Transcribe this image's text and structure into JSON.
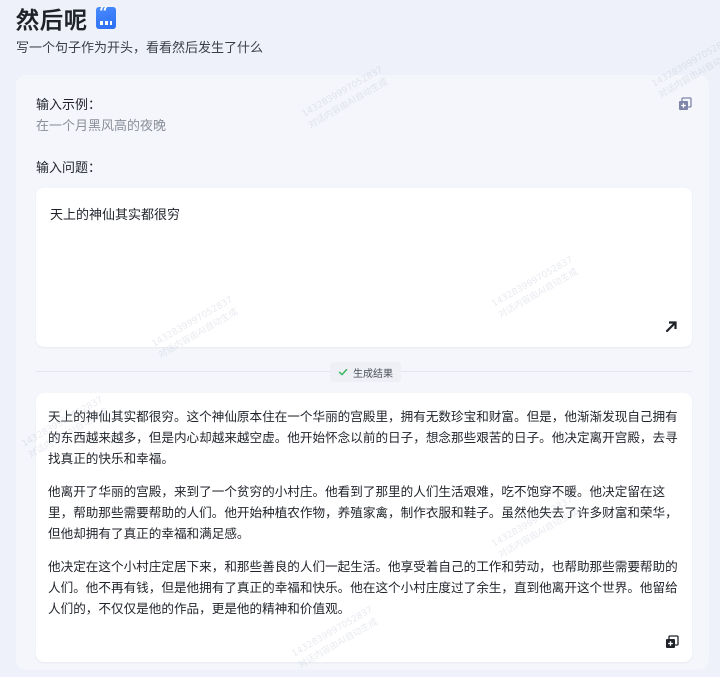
{
  "header": {
    "title": "然后呢",
    "subtitle": "写一个句子作为开头，看看然后发生了什么"
  },
  "example": {
    "label": "输入示例：",
    "text": "在一个月黑风高的夜晚"
  },
  "question": {
    "label": "输入问题：",
    "value": "天上的神仙其实都很穷"
  },
  "result": {
    "tag": "生成结果",
    "paragraphs": [
      "天上的神仙其实都很穷。这个神仙原本住在一个华丽的宫殿里，拥有无数珍宝和财富。但是，他渐渐发现自己拥有的东西越来越多，但是内心却越来越空虚。他开始怀念以前的日子，想念那些艰苦的日子。他决定离开宫殿，去寻找真正的快乐和幸福。",
      "他离开了华丽的宫殿，来到了一个贫穷的小村庄。他看到了那里的人们生活艰难，吃不饱穿不暖。他决定留在这里，帮助那些需要帮助的人们。他开始种植农作物，养殖家禽，制作衣服和鞋子。虽然他失去了许多财富和荣华，但他却拥有了真正的幸福和满足感。",
      "他决定在这个小村庄定居下来，和那些善良的人们一起生活。他享受着自己的工作和劳动，也帮助那些需要帮助的人们。他不再有钱，但是他拥有了真正的幸福和快乐。他在这个小村庄度过了余生，直到他离开这个世界。他留给人们的，不仅仅是他的作品，更是他的精神和价值观。"
    ]
  },
  "watermark": {
    "line1": "14328399970528​37",
    "line2": "对话内容由AI自动生成"
  },
  "icons": {
    "title": "quote-chat-icon",
    "copy_top": "copy-icon",
    "send": "arrow-up-right-icon",
    "check": "check-icon",
    "copy_bottom": "copy-icon"
  },
  "colors": {
    "background": "#eef1f9",
    "panel": "#f4f6fb",
    "accent": "#2a6cf0",
    "check": "#35b45a"
  }
}
